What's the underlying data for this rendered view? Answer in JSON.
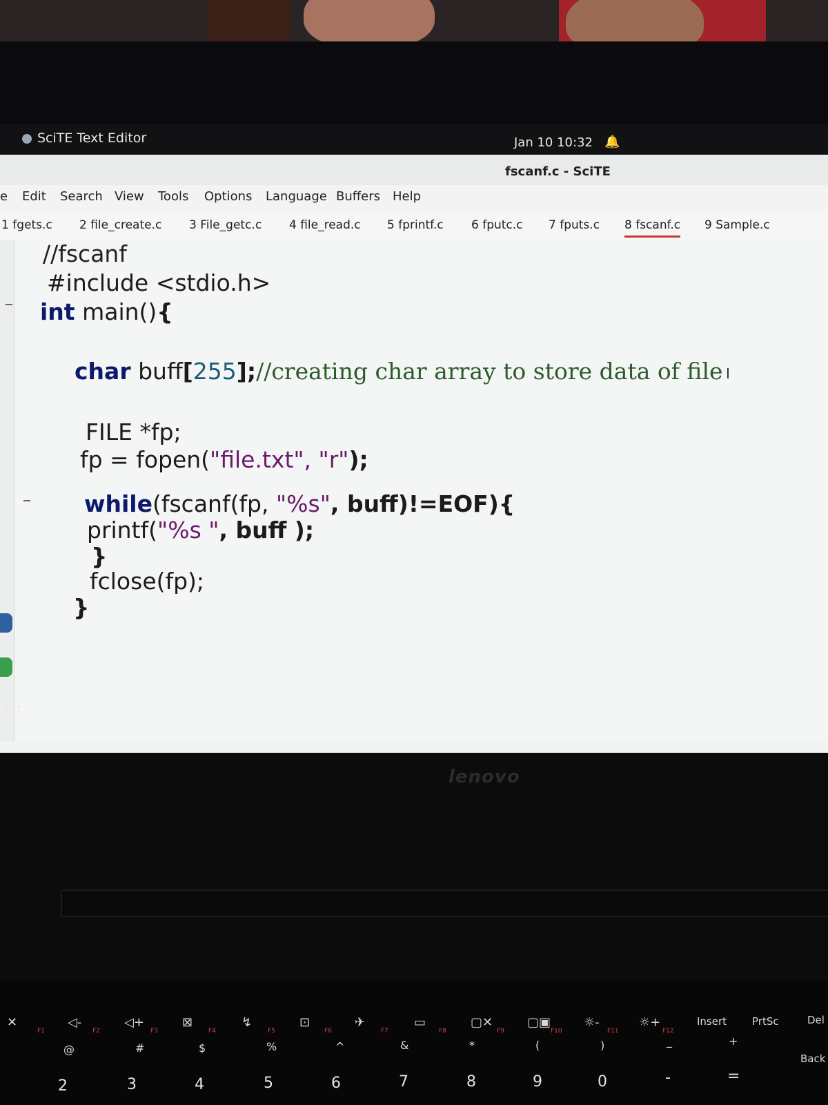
{
  "topbar": {
    "app_name": "SciTE Text Editor",
    "clock": "Jan 10 10:32"
  },
  "window": {
    "title": "fscanf.c - SciTE"
  },
  "menu": [
    "e",
    "Edit",
    "Search",
    "View",
    "Tools",
    "Options",
    "Language",
    "Buffers",
    "Help"
  ],
  "tabs": [
    {
      "label": "1 fgets.c",
      "active": false
    },
    {
      "label": "2 file_create.c",
      "active": false
    },
    {
      "label": "3 File_getc.c",
      "active": false
    },
    {
      "label": "4 file_read.c",
      "active": false
    },
    {
      "label": "5 fprintf.c",
      "active": false
    },
    {
      "label": "6 fputc.c",
      "active": false
    },
    {
      "label": "7 fputs.c",
      "active": false
    },
    {
      "label": "8 fscanf.c",
      "active": true
    },
    {
      "label": "9 Sample.c",
      "active": false
    }
  ],
  "code": {
    "l1": "//fscanf",
    "l2": "#include <stdio.h>",
    "l3_kw": "int",
    "l3_rest": " main()",
    "l3_brace": "{",
    "l4_kw": "char",
    "l4_name": " buff",
    "l4_open": "[",
    "l4_num": "255",
    "l4_close": "];",
    "l4_comment": "//creating char array to store data of file",
    "l5": "FILE *fp;",
    "l6_a": "fp = fopen(",
    "l6_str": "\"file.txt\", \"r\"",
    "l6_b": ");",
    "l7_kw": "while",
    "l7_a": "(fscanf(fp, ",
    "l7_str": "\"%s\"",
    "l7_b": ", buff)!=EOF){",
    "l8_a": "printf(",
    "l8_str": "\"%s \"",
    "l8_b": ", buff );",
    "l9": "}",
    "l10": "fclose(fp);",
    "l11": "}"
  },
  "laptop": {
    "brand": "lenovo"
  },
  "keyboard": {
    "fn_keys": [
      {
        "label": "✕",
        "sub": "F1"
      },
      {
        "label": "◁-",
        "sub": "F2"
      },
      {
        "label": "◁+",
        "sub": "F3"
      },
      {
        "label": "⊠",
        "sub": "F4"
      },
      {
        "label": "↯",
        "sub": "F5"
      },
      {
        "label": "⊡",
        "sub": "F6"
      },
      {
        "label": "✈",
        "sub": "F7"
      },
      {
        "label": "▭",
        "sub": "F8"
      },
      {
        "label": "▢✕",
        "sub": "F9"
      },
      {
        "label": "▢▣",
        "sub": "F10"
      },
      {
        "label": "☼-",
        "sub": "F11"
      },
      {
        "label": "☼+",
        "sub": "F12"
      },
      {
        "label": "Insert",
        "sub": ""
      },
      {
        "label": "PrtSc",
        "sub": ""
      },
      {
        "label": "Del",
        "sub": ""
      }
    ],
    "num_keys": [
      {
        "sym": "@",
        "num": "2"
      },
      {
        "sym": "#",
        "num": "3"
      },
      {
        "sym": "$",
        "num": "4"
      },
      {
        "sym": "%",
        "num": "5"
      },
      {
        "sym": "^",
        "num": "6"
      },
      {
        "sym": "&",
        "num": "7"
      },
      {
        "sym": "*",
        "num": "8"
      },
      {
        "sym": "(",
        "num": "9"
      },
      {
        "sym": ")",
        "num": "0"
      },
      {
        "sym": "_",
        "num": "-"
      },
      {
        "sym": "+",
        "num": "="
      },
      {
        "sym": "",
        "num": "Back"
      }
    ]
  }
}
